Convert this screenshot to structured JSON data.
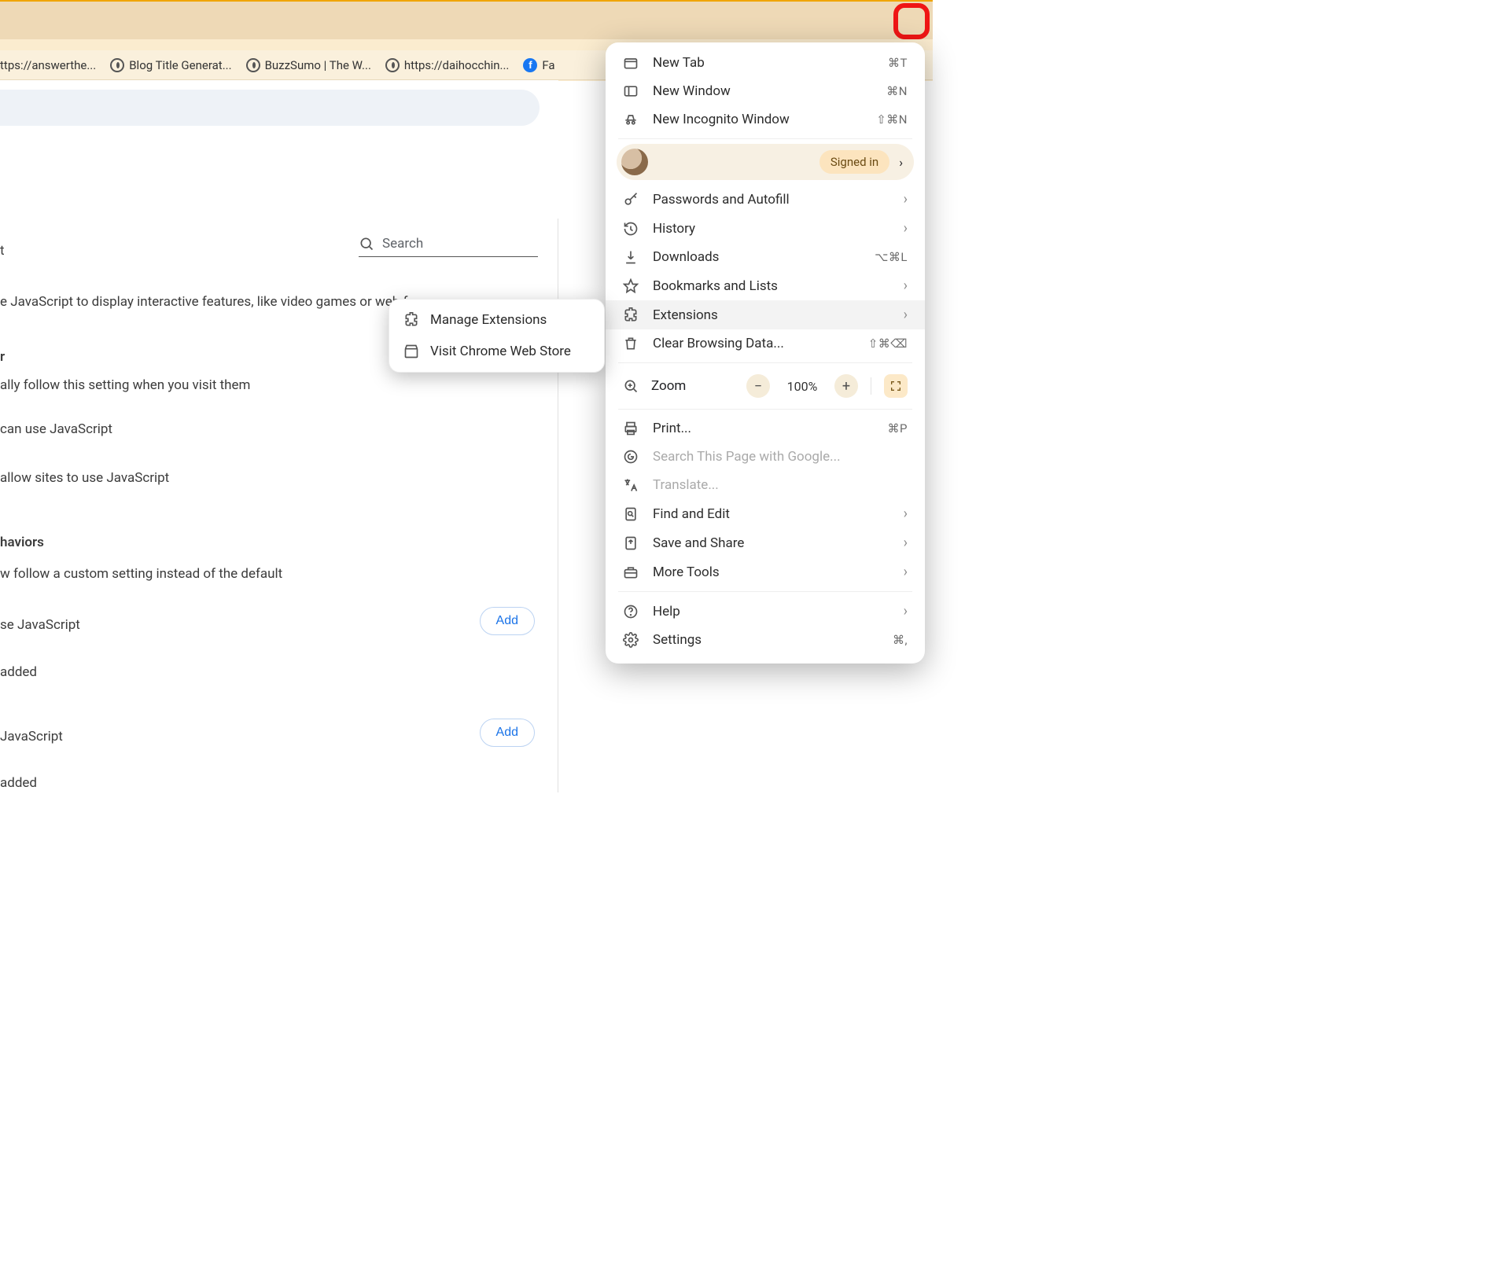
{
  "toolbar": {
    "star_icon": "star-icon",
    "qr_icon": "qr-icon",
    "ext_icon": "extensions-icon"
  },
  "bookmarks": [
    {
      "label": "ttps://answerthe...",
      "icon": "none"
    },
    {
      "label": "Blog Title Generat...",
      "icon": "globe"
    },
    {
      "label": "BuzzSumo | The W...",
      "icon": "globe"
    },
    {
      "label": "https://daihocchin...",
      "icon": "globe"
    },
    {
      "label": "Fa",
      "icon": "fb"
    }
  ],
  "settings_page": {
    "search_placeholder": "Search",
    "lines": {
      "t207": "t",
      "l1": "e JavaScript to display interactive features, like video games or web forms",
      "l2": "r",
      "l3": "ally follow this setting when you visit them",
      "l4": "can use JavaScript",
      "l5": "allow sites to use JavaScript",
      "l6": "haviors",
      "l7": "w follow a custom setting instead of the default",
      "l8": "se JavaScript",
      "l9": "added",
      "l10": "JavaScript",
      "l11": "added"
    },
    "add_label": "Add"
  },
  "submenu": {
    "manage": "Manage Extensions",
    "store": "Visit Chrome Web Store"
  },
  "menu": {
    "new_tab": "New Tab",
    "new_tab_sc": "⌘T",
    "new_win": "New Window",
    "new_win_sc": "⌘N",
    "incog": "New Incognito Window",
    "incog_sc": "⇧⌘N",
    "signed": "Signed in",
    "passwords": "Passwords and Autofill",
    "history": "History",
    "downloads": "Downloads",
    "downloads_sc": "⌥⌘L",
    "bookmarks": "Bookmarks and Lists",
    "extensions": "Extensions",
    "clear": "Clear Browsing Data...",
    "clear_sc": "⇧⌘⌫",
    "zoom": "Zoom",
    "zoom_val": "100%",
    "print": "Print...",
    "print_sc": "⌘P",
    "searchpage": "Search This Page with Google...",
    "translate": "Translate...",
    "find": "Find and Edit",
    "share": "Save and Share",
    "more": "More Tools",
    "help": "Help",
    "settings": "Settings",
    "settings_sc": "⌘,"
  }
}
